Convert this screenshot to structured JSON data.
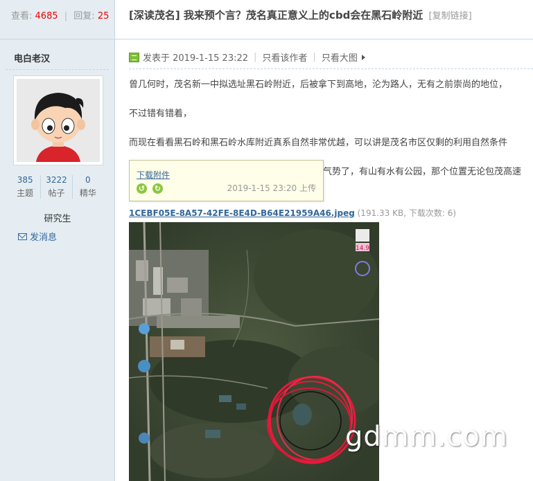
{
  "thread": {
    "views_label": "查看:",
    "views": "4685",
    "replies_label": "回复:",
    "replies": "25",
    "sep": "|",
    "title": "[深读茂名] 我来预个言？茂名真正意义上的cbd会在黑石岭附近",
    "copy_link": "[复制链接]"
  },
  "author": {
    "name": "电白老汉",
    "stats": [
      {
        "value": "385",
        "label": "主题"
      },
      {
        "value": "3222",
        "label": "帖子"
      },
      {
        "value": "0",
        "label": "精华"
      }
    ],
    "rank": "研究生",
    "send_message": "发消息"
  },
  "post": {
    "posted_at": "发表于 2019-1-15 23:22",
    "only_author": "只看该作者",
    "large_image": "只看大图",
    "pipe": "|",
    "paragraphs": [
      "曾几何时，茂名新一中拟选址黑石岭附近，后被拿下到高地，沦为路人，无有之前崇尚的地位，",
      "不过错有错着，",
      "而现在看看黑石岭和黑石岭水库附近真系自然非常优越，可以讲是茂名市区仅剩的利用自然条件",
      "气势了，有山有水有公园，那个位置无论包茂高速"
    ]
  },
  "attachment": {
    "tip_download": "下载附件",
    "tip_time": "2019-1-15 23:20 上传",
    "filename": "1CEBF05E-8A57-42FE-8E4D-B64E21959A46.jpeg",
    "info": "(191.33 KB, 下载次数: 6)",
    "map_scale": "14.9"
  },
  "watermark": "gdmm.com",
  "colors": {
    "accent_link": "#336699",
    "count_red": "#ee0000",
    "sidebar_bg": "#e5edf2",
    "map_circle": "#e8193c"
  }
}
